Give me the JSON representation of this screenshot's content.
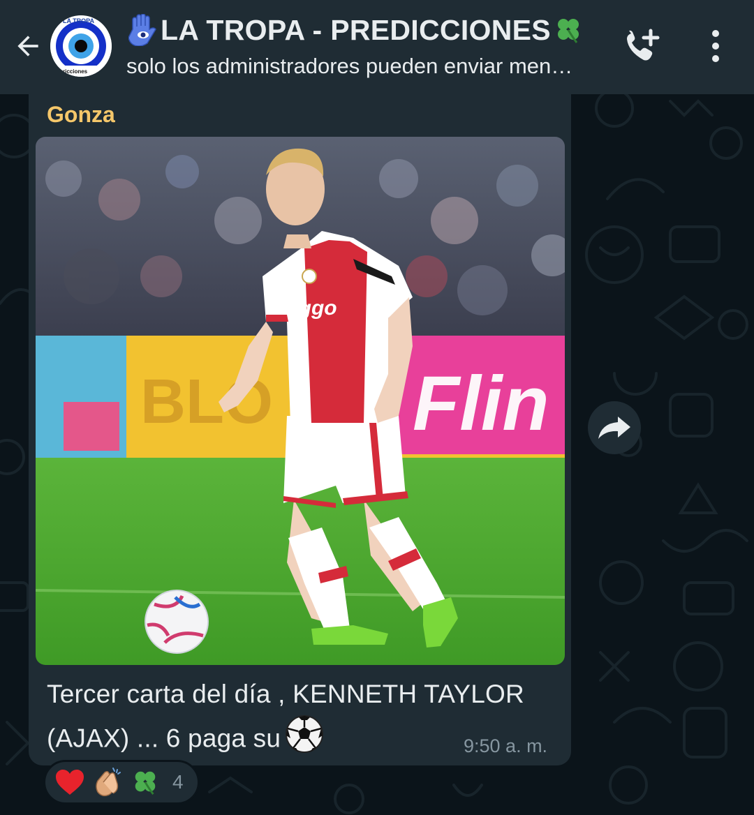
{
  "header": {
    "title": "LA TROPA - PREDICCIONES",
    "subtitle": "solo los administradores pueden enviar men…",
    "avatar_tag_top": "LA TROPA",
    "avatar_tag_bottom": "ricciones",
    "icons": {
      "back": "arrow-left-icon",
      "title_prefix": "hamsa-hand-icon",
      "title_suffix": "four-leaf-clover-icon",
      "call": "add-call-icon",
      "menu": "more-vert-icon"
    }
  },
  "message": {
    "sender": "Gonza",
    "image_alt": "Football player in Ajax kit with a ball on the pitch",
    "caption_line1": "Tercer carta del día , KENNETH TAYLOR",
    "caption_line2": "(AJAX) ... 6 paga su",
    "caption_emoji": "soccer-ball-icon",
    "time": "9:50 a. m."
  },
  "reactions": {
    "items": [
      "red-heart-icon",
      "clapping-hands-icon",
      "four-leaf-clover-icon"
    ],
    "count": "4"
  },
  "colors": {
    "header_bg": "#1f2c34",
    "chat_bg": "#0b141a",
    "bubble_bg": "#1f2c34",
    "sender_color": "#f5c76a",
    "meta_text": "#8696a0"
  }
}
